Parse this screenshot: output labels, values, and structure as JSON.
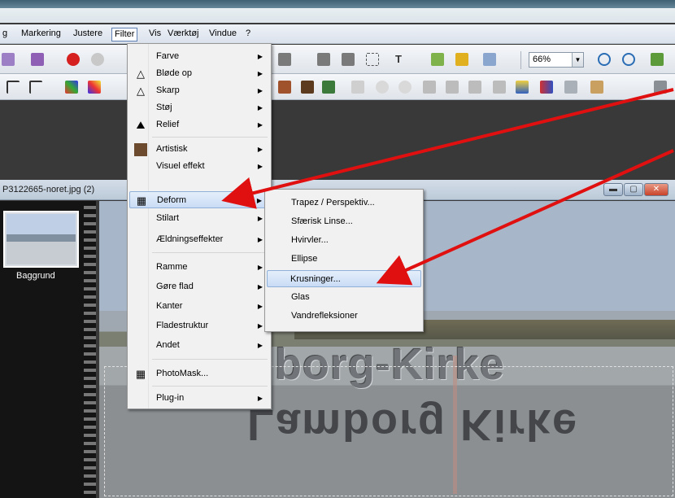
{
  "menubar": {
    "items": [
      "g",
      "Markering",
      "Justere",
      "Filter",
      "Vis",
      "Værktøj",
      "Vindue",
      "?"
    ]
  },
  "toolbar": {
    "zoom_value": "66%"
  },
  "document": {
    "title": "P3122665-noret.jpg (2)"
  },
  "layers": {
    "layer_name": "Baggrund"
  },
  "canvas": {
    "text": "lborg-Kirke",
    "reflection": "Lamborg Kirke"
  },
  "filter_menu": {
    "items": [
      {
        "label": "Farve",
        "submenu": true,
        "icon": ""
      },
      {
        "label": "Bløde op",
        "submenu": true,
        "icon": "drop-icon"
      },
      {
        "label": "Skarp",
        "submenu": true,
        "icon": "triangle-icon"
      },
      {
        "label": "Støj",
        "submenu": true,
        "icon": ""
      },
      {
        "label": "Relief",
        "submenu": true,
        "icon": "relief-icon"
      },
      {
        "label": "Artistisk",
        "submenu": true,
        "icon": "portrait-icon"
      },
      {
        "label": "Visuel effekt",
        "submenu": true,
        "icon": ""
      },
      {
        "label": "Deform",
        "submenu": true,
        "icon": "grid-icon",
        "highlighted": true
      },
      {
        "label": "Stilart",
        "submenu": true,
        "icon": ""
      },
      {
        "label": "Ældningseffekter",
        "submenu": true,
        "icon": ""
      },
      {
        "label": "Ramme",
        "submenu": true,
        "icon": ""
      },
      {
        "label": "Gøre flad",
        "submenu": true,
        "icon": ""
      },
      {
        "label": "Kanter",
        "submenu": true,
        "icon": ""
      },
      {
        "label": "Fladestruktur",
        "submenu": true,
        "icon": ""
      },
      {
        "label": "Andet",
        "submenu": true,
        "icon": ""
      },
      {
        "label": "PhotoMask...",
        "submenu": false,
        "icon": "photomask-icon"
      },
      {
        "label": "Plug-in",
        "submenu": true,
        "icon": ""
      }
    ]
  },
  "deform_submenu": {
    "items": [
      {
        "label": "Trapez / Perspektiv..."
      },
      {
        "label": "Sfærisk Linse..."
      },
      {
        "label": "Hvirvler..."
      },
      {
        "label": "Ellipse"
      },
      {
        "label": "Krusninger...",
        "highlighted": true
      },
      {
        "label": "Glas"
      },
      {
        "label": "Vandrefleksioner"
      }
    ]
  },
  "colors": {
    "arrow": "#e01010",
    "highlight": "#c9dcf5"
  }
}
